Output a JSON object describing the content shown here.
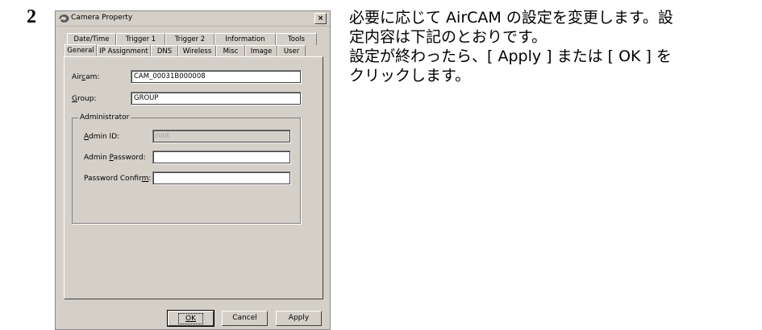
{
  "step": "2",
  "instruction": {
    "line1": "必要に応じて AirCAM の設定を変更します。設",
    "line2": "定内容は下記のとおりです。",
    "line3": "設定が終わったら、[ Apply ] または [ OK ] を",
    "line4": "クリックします。"
  },
  "dialog": {
    "title": "Camera Property",
    "close": "×",
    "tabs_back": [
      "Date/Time",
      "Trigger 1",
      "Trigger 2",
      "Information",
      "Tools"
    ],
    "tabs_front": [
      "General",
      "IP Assignment",
      "DNS",
      "Wireless",
      "Misc",
      "Image",
      "User"
    ],
    "active_tab": "General",
    "aircam_label_pre": "Air",
    "aircam_label_key": "c",
    "aircam_label_post": "am:",
    "aircam_value": "CAM_00031B000008",
    "group_label_key": "G",
    "group_label_post": "roup:",
    "group_value": "GROUP",
    "administrator": {
      "title": "Administrator",
      "admin_id_key": "A",
      "admin_id_post": "dmin ID:",
      "admin_id_value": "root",
      "admin_password_pre": "Admin ",
      "admin_password_key": "P",
      "admin_password_post": "assword:",
      "admin_password_value": "",
      "password_confirm_pre": "Password Confir",
      "password_confirm_key": "m",
      "password_confirm_post": ":",
      "password_confirm_value": ""
    },
    "buttons": {
      "ok": "OK",
      "cancel": "Cancel",
      "apply": "Apply"
    }
  }
}
